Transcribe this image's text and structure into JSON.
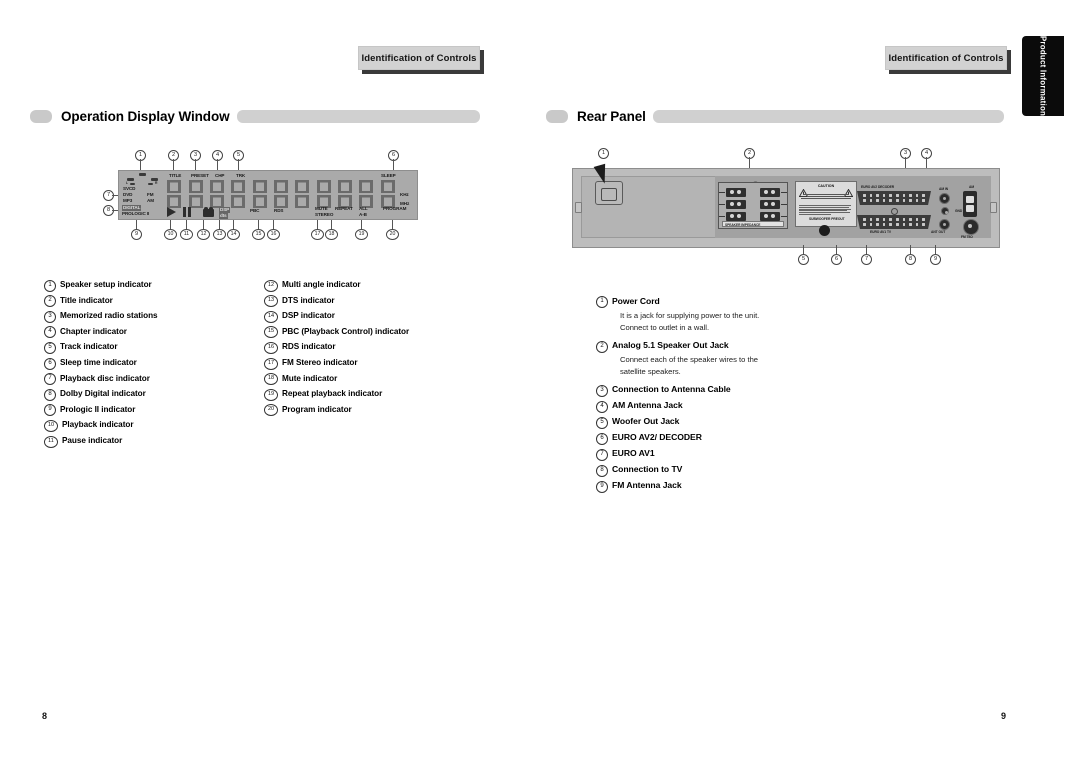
{
  "spread": {
    "left_page": {
      "folio": "8",
      "chapter_tab": "Identification of Controls",
      "section_title": "Operation Display Window",
      "display_panel": {
        "labels": {
          "title": "TITLE",
          "preset": "PRESET",
          "chp": "CHP",
          "trk": "TRK",
          "sleep": "SLEEP",
          "khz": "KHz",
          "mhz": "MHz",
          "svcd": "SVCD",
          "dvd": "DVD",
          "mp3": "MP3",
          "fm": "FM",
          "am": "AM",
          "dolby_digital": "DIGITAL",
          "prologic": "PROLOGIC II",
          "dsp": "DSP",
          "pbc": "PBC",
          "rds": "RDS",
          "mute": "MUTE",
          "stereo": "STEREO",
          "repeat": "REPEAT",
          "all": "ALL",
          "ab": "A-B",
          "program": "PROGRAM",
          "spk_left": "L",
          "spk_right": "R"
        },
        "callouts_top": [
          "1",
          "2",
          "3",
          "4",
          "5",
          "6"
        ],
        "callouts_left": [
          "7",
          "8"
        ],
        "callouts_bottom": [
          "9",
          "10",
          "11",
          "12",
          "13",
          "14",
          "15",
          "16",
          "17",
          "18",
          "19",
          "20"
        ]
      },
      "index_column_1": [
        {
          "n": "1",
          "text": "Speaker setup indicator"
        },
        {
          "n": "2",
          "text": "Title indicator"
        },
        {
          "n": "3",
          "text": "Memorized radio stations"
        },
        {
          "n": "4",
          "text": "Chapter indicator"
        },
        {
          "n": "5",
          "text": "Track indicator"
        },
        {
          "n": "6",
          "text": "Sleep time indicator"
        },
        {
          "n": "7",
          "text": "Playback disc indicator"
        },
        {
          "n": "8",
          "text": "Dolby Digital indicator"
        },
        {
          "n": "9",
          "text": "Prologic II indicator"
        },
        {
          "n": "10",
          "text": "Playback indicator"
        },
        {
          "n": "11",
          "text": "Pause indicator"
        }
      ],
      "index_column_2": [
        {
          "n": "12",
          "text": "Multi angle indicator"
        },
        {
          "n": "13",
          "text": "DTS indicator"
        },
        {
          "n": "14",
          "text": "DSP indicator"
        },
        {
          "n": "15",
          "text": "PBC (Playback Control) indicator"
        },
        {
          "n": "16",
          "text": "RDS indicator"
        },
        {
          "n": "17",
          "text": "FM Stereo indicator"
        },
        {
          "n": "18",
          "text": "Mute indicator"
        },
        {
          "n": "19",
          "text": "Repeat playback indicator"
        },
        {
          "n": "20",
          "text": "Program indicator"
        }
      ]
    },
    "right_page": {
      "folio": "9",
      "chapter_tab": "Identification of Controls",
      "thumb_tab": "Product Information",
      "section_title": "Rear Panel",
      "rear_panel": {
        "callouts_top": [
          "1",
          "2",
          "3",
          "4"
        ],
        "callouts_bottom": [
          "5",
          "6",
          "7",
          "8",
          "9"
        ],
        "labels": {
          "speaker_legend": "SPEAKER IMPEDANCE",
          "caution_title": "CAUTION",
          "subwoofer_preout": "SUBWOOFER PREOUT",
          "euro_av2_decoder": "EURO AV2 DECODER",
          "euro_av1_tv": "EURO AV1 TV",
          "am_in": "AM IN",
          "gnd": "GND",
          "ant_out": "ANT OUT",
          "fm_75": "FM 75Ω"
        }
      },
      "descriptions": [
        {
          "n": "1",
          "title": "Power Cord",
          "body": [
            "It is a jack for supplying power to the unit.",
            "Connect to outlet in a wall."
          ]
        },
        {
          "n": "2",
          "title": "Analog 5.1 Speaker Out Jack",
          "body": [
            "Connect each of the speaker wires to the",
            "satellite speakers."
          ]
        },
        {
          "n": "3",
          "title": "Connection to Antenna Cable",
          "body": []
        },
        {
          "n": "4",
          "title": "AM Antenna Jack",
          "body": []
        },
        {
          "n": "5",
          "title": "Woofer Out Jack",
          "body": []
        },
        {
          "n": "6",
          "title": "EURO AV2/ DECODER",
          "body": []
        },
        {
          "n": "7",
          "title": "EURO AV1",
          "body": []
        },
        {
          "n": "8",
          "title": "Connection to TV",
          "body": []
        },
        {
          "n": "9",
          "title": "FM Antenna Jack",
          "body": []
        }
      ]
    }
  }
}
